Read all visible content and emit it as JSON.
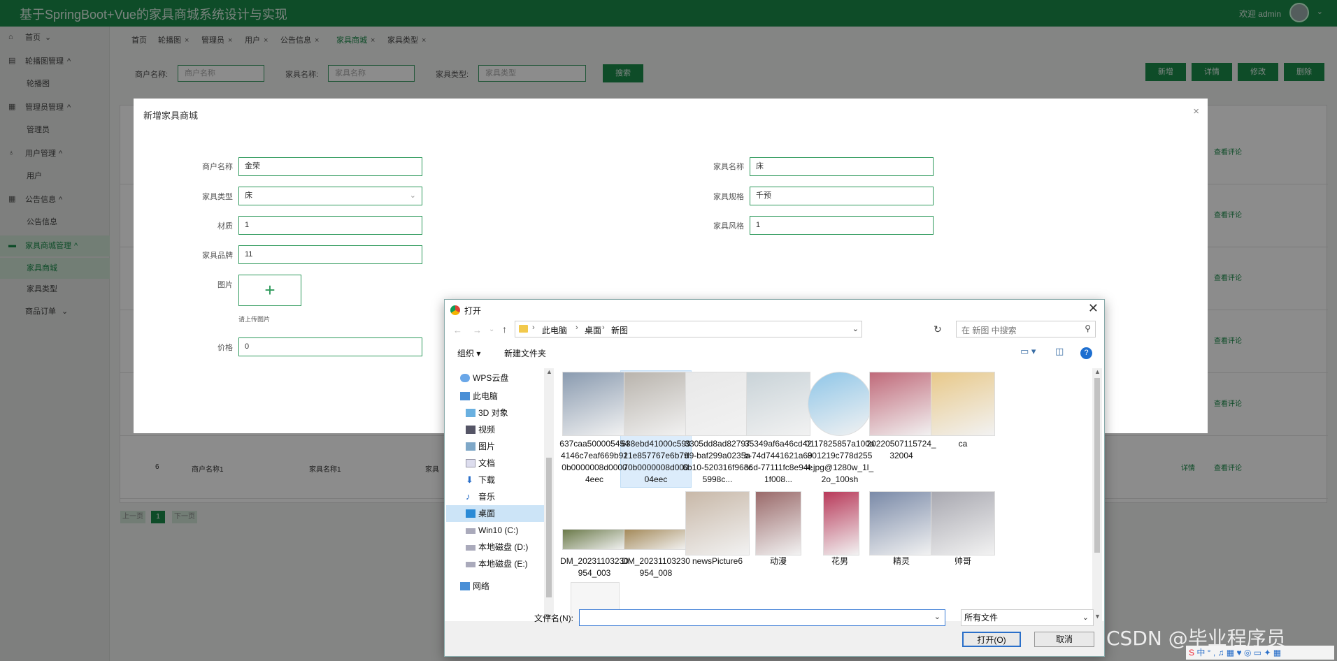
{
  "app": {
    "title": "基于SpringBoot+Vue的家具商城系统设计与实现",
    "welcome": "欢迎 admin"
  },
  "sidebar": [
    {
      "label": "首页",
      "icon": "home-icon",
      "sub": false,
      "caret": "⌄"
    },
    {
      "label": "轮播图管理",
      "icon": "carousel-icon",
      "sub": false,
      "caret": "^"
    },
    {
      "label": "轮播图",
      "sub": true
    },
    {
      "label": "管理员管理",
      "icon": "admin-icon",
      "sub": false,
      "caret": "^"
    },
    {
      "label": "管理员",
      "sub": true
    },
    {
      "label": "用户管理",
      "icon": "user-icon",
      "sub": false,
      "caret": "^"
    },
    {
      "label": "用户",
      "sub": true
    },
    {
      "label": "公告信息",
      "icon": "notice-icon",
      "sub": false,
      "caret": "^"
    },
    {
      "label": "公告信息",
      "sub": true
    },
    {
      "label": "家具商城管理",
      "icon": "shop-icon",
      "sub": false,
      "caret": "^",
      "active": true
    },
    {
      "label": "家具商城",
      "sub": true,
      "active": true
    },
    {
      "label": "家具类型",
      "sub": true
    },
    {
      "label": "商品订单",
      "sub": false,
      "caret": "⌄"
    }
  ],
  "tabs": [
    {
      "label": "首页",
      "close": ""
    },
    {
      "label": "轮播图",
      "close": "×"
    },
    {
      "label": "管理员",
      "close": "×"
    },
    {
      "label": "用户",
      "close": "×"
    },
    {
      "label": "公告信息",
      "close": "×"
    },
    {
      "label": "家具商城",
      "close": "×",
      "active": true
    },
    {
      "label": "家具类型",
      "close": "×"
    }
  ],
  "filters": {
    "merchant_label": "商户名称:",
    "merchant_placeholder": "商户名称",
    "name_label": "家具名称:",
    "name_placeholder": "家具名称",
    "type_label": "家具类型:",
    "type_placeholder": "家具类型",
    "search": "搜索"
  },
  "actions": {
    "add": "新增",
    "detail": "详情",
    "edit": "修改",
    "delete": "删除"
  },
  "table": {
    "view_comments": "查看评论",
    "detail": "详情",
    "last_row": {
      "index": "6",
      "merchant": "商户名称1",
      "name": "家具名称1",
      "partial": "家具"
    }
  },
  "pagination": {
    "prev": "上一页",
    "page": "1",
    "next": "下一页"
  },
  "dialog": {
    "title": "新增家具商城",
    "close": "×",
    "fields": {
      "merchant": {
        "label": "商户名称",
        "value": "金荣"
      },
      "type": {
        "label": "家具类型",
        "value": "床"
      },
      "material": {
        "label": "材质",
        "value": "1"
      },
      "brand": {
        "label": "家具品牌",
        "value": "11"
      },
      "image": {
        "label": "图片",
        "hint": "请上传图片"
      },
      "price": {
        "label": "价格",
        "value": "0"
      },
      "name": {
        "label": "家具名称",
        "value": "床"
      },
      "spec": {
        "label": "家具规格",
        "value": "千预"
      },
      "style": {
        "label": "家具风格",
        "value": "1"
      }
    }
  },
  "file_dialog": {
    "title": "打开",
    "breadcrumb": [
      "此电脑",
      "桌面",
      "新图"
    ],
    "search_placeholder": "在 新图 中搜索",
    "organize": "组织 ▾",
    "new_folder": "新建文件夹",
    "tree": [
      {
        "label": "WPS云盘",
        "icon": "cloud-icon"
      },
      {
        "label": "此电脑",
        "icon": "computer-icon"
      },
      {
        "label": "3D 对象",
        "icon": "3d-objects-icon"
      },
      {
        "label": "视频",
        "icon": "video-icon"
      },
      {
        "label": "图片",
        "icon": "pictures-icon"
      },
      {
        "label": "文档",
        "icon": "documents-icon"
      },
      {
        "label": "下载",
        "icon": "download-icon"
      },
      {
        "label": "音乐",
        "icon": "music-icon"
      },
      {
        "label": "桌面",
        "icon": "desktop-icon",
        "selected": true
      },
      {
        "label": "Win10 (C:)",
        "icon": "drive-icon"
      },
      {
        "label": "本地磁盘 (D:)",
        "icon": "drive-icon"
      },
      {
        "label": "本地磁盘 (E:)",
        "icon": "drive-icon"
      },
      {
        "label": "网络",
        "icon": "network-icon"
      }
    ],
    "files": [
      {
        "name": "637caa5000054544146c7eaf669b910b0000008d00004eec",
        "color": "#8a9bb0"
      },
      {
        "name": "638ebd41000c59921e857767e6b7970b0000008d00004eec",
        "color": "#b9b4ad",
        "selected": true
      },
      {
        "name": "3305dd8ad82797d9-baf299a0235a6b10-520316f96cc5998c...",
        "color": "#e8e8e8"
      },
      {
        "name": "35349af6a46cd42b-74d7441621a6936d-77111fc8e94e1f008...",
        "color": "#c9d3d8"
      },
      {
        "name": "0117825857a100a801219c778d2554.jpg@1280w_1l_2o_100sh",
        "color": "#8fc6e8"
      },
      {
        "name": "20220507115724_32004",
        "color": "#c06a7a"
      },
      {
        "name": "ca",
        "color": "#e8c98a"
      },
      {
        "name": "DM_20231103230954_003",
        "color": "#6b7a4a"
      },
      {
        "name": "DM_20231103230954_008",
        "color": "#a48a5a"
      },
      {
        "name": "newsPicture6",
        "color": "#c8b8a8"
      },
      {
        "name": "动漫",
        "color": "#9a6a6a"
      },
      {
        "name": "花男",
        "color": "#b83a5a"
      },
      {
        "name": "精灵",
        "color": "#7a8aa8"
      },
      {
        "name": "帅哥",
        "color": "#a8a8b0"
      }
    ],
    "filename_label": "文件名(N):",
    "filename_value": "",
    "filetype": "所有文件",
    "open": "打开(O)",
    "cancel": "取消"
  },
  "watermark": "CSDN @毕业程序员",
  "colors": {
    "brand": "#1b8a4a",
    "accent": "#2f9a5c",
    "selection": "#cce4f7"
  }
}
